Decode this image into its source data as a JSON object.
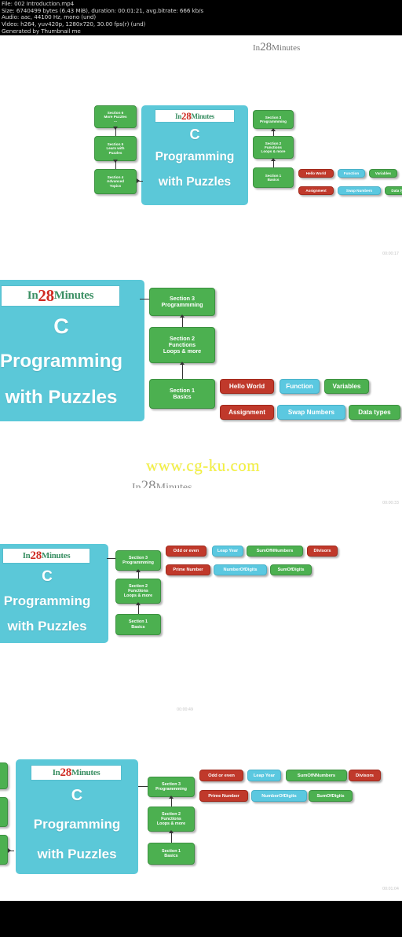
{
  "header": {
    "line_file": "File: 002 Introduction.mp4",
    "line_size": "Size: 6740499 bytes (6.43 MiB), duration: 00:01:21, avg.bitrate: 666 kb/s",
    "line_audio": "Audio: aac, 44100 Hz, mono (und)",
    "line_video": "Video: h264, yuv420p, 1280x720, 30.00 fps(r) (und)",
    "line_generated": "Generated by Thumbnail me"
  },
  "watermark": "www.cg-ku.com",
  "logo": {
    "part1": "In",
    "part2": "28",
    "part3": "Minutes"
  },
  "slide_title": {
    "line1": "C",
    "line2": "Programming",
    "line3": "with Puzzles"
  },
  "sections": {
    "s6": "Section 6\nMore Puzzles\n...",
    "s6_l1": "Section 6",
    "s6_l2": "More Puzzles",
    "s6_l3": "...",
    "s5_l1": "Section 5",
    "s5_l2": "Learn with",
    "s5_l3": "Puzzles",
    "s4_l1": "Section 4",
    "s4_l2": "Advanced",
    "s4_l3": "Topics",
    "s3_l1": "Section 3",
    "s3_l2": "Programmming",
    "s2_l1": "Section 2",
    "s2_l2": "Functions",
    "s2_l3": "Loops & more",
    "s1_l1": "Section 1",
    "s1_l2": "Basics"
  },
  "tags_basics": [
    {
      "label": "Hello World",
      "color": "red"
    },
    {
      "label": "Function",
      "color": "cyan"
    },
    {
      "label": "Variables",
      "color": "green"
    },
    {
      "label": "Assignment",
      "color": "red"
    },
    {
      "label": "Swap Numbers",
      "color": "cyan"
    },
    {
      "label": "Data types",
      "color": "green"
    }
  ],
  "tags_puzzles": [
    {
      "label": "Odd or even",
      "color": "red"
    },
    {
      "label": "Leap Year",
      "color": "cyan"
    },
    {
      "label": "SumOfNNumbers",
      "color": "green"
    },
    {
      "label": "Divisors",
      "color": "red"
    },
    {
      "label": "Prime Number",
      "color": "red"
    },
    {
      "label": "NumberOfDigits",
      "color": "cyan"
    },
    {
      "label": "SumOfDigits",
      "color": "green"
    }
  ],
  "timestamps": {
    "t1": "00:00:17",
    "t2": "00:00:33",
    "t3": "00:00:49",
    "t4": "00:01:04"
  },
  "colors": {
    "panel_cyan": "#5bc8d8",
    "box_green": "#4cb050",
    "tag_red": "#c0392b",
    "tag_cyan": "#5bc8e0",
    "watermark_yellow": "#f5f23c",
    "header_bg": "#000000"
  }
}
